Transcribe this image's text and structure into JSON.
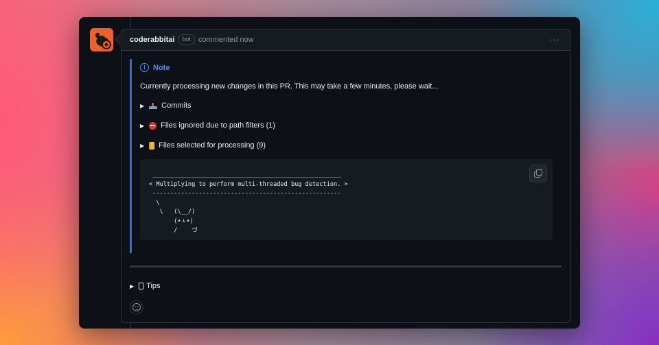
{
  "comment": {
    "author": "coderabbitai",
    "badge": "bot",
    "action": "commented now",
    "menu_icon": "kebab-horizontal-icon"
  },
  "note": {
    "title": "Note",
    "text": "Currently processing new changes in this PR. This may take a few minutes, please wait...",
    "accent_color": "#2f6fd6"
  },
  "details": [
    {
      "label": "Commits",
      "icon": "commit-emoji-icon"
    },
    {
      "label": "Files ignored due to path filters (1)",
      "icon": "no-entry-icon"
    },
    {
      "label": "Files selected for processing (9)",
      "icon": "ledger-icon"
    }
  ],
  "code": {
    "ascii": " _____________________________________________________\n< Multiplying to perform multi-threaded bug detection. >\n -----------------------------------------------------\n  \\\n   \\   (\\__/)\n       (•ㅅ•)\n       /    づ"
  },
  "tips": {
    "label": "Tips"
  },
  "colors": {
    "window_bg": "#0d1117",
    "header_bg": "#161b22",
    "border": "#30363d",
    "link_blue": "#4493f8"
  }
}
